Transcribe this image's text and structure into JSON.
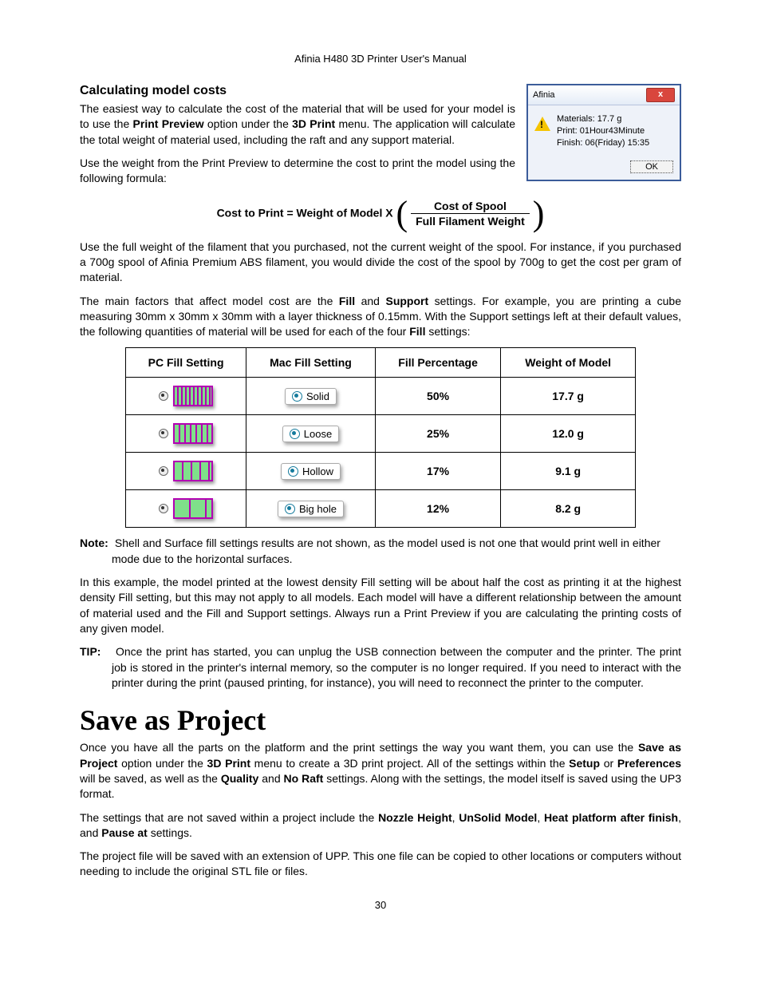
{
  "header": "Afinia H480 3D Printer User's Manual",
  "h_calc": "Calculating model costs",
  "dialog": {
    "title": "Afinia",
    "msg": "Materials: 17.7 g\nPrint: 01Hour43Minute\nFinish: 06(Friday) 15:35",
    "ok": "OK"
  },
  "p1a": "The easiest way to calculate the cost of the material that will be used for your model is to use the ",
  "p1b": "Print Preview",
  "p1c": " option under the ",
  "p1d": "3D Print",
  "p1e": " menu. The application will calculate the total weight of material used, including the raft and any support material.",
  "p2": "Use the weight from the Print Preview to determine the cost to print the model using the following formula:",
  "formula": {
    "lhs": "Cost to Print = Weight of Model X",
    "top": "Cost of Spool",
    "bot": "Full Filament Weight"
  },
  "p3": "Use the full weight of the filament that you purchased, not the current weight of the spool. For instance, if you purchased a 700g spool of Afinia Premium ABS filament, you would divide the cost of the spool by 700g to get the cost per gram of material.",
  "p4a": "The main factors that affect model cost are the ",
  "p4b": "Fill",
  "p4c": " and ",
  "p4d": "Support",
  "p4e": " settings. For example, you are printing a cube measuring 30mm x 30mm x 30mm with a layer thickness of 0.15mm. With the Support settings left at their default values, the following quantities of material will be used for each of the four ",
  "p4f": "Fill",
  "p4g": " settings:",
  "th": {
    "c1": "PC Fill Setting",
    "c2": "Mac Fill Setting",
    "c3": "Fill Percentage",
    "c4": "Weight of Model"
  },
  "rows": [
    {
      "mac": "Solid",
      "pct": "50%",
      "wt": "17.7 g"
    },
    {
      "mac": "Loose",
      "pct": "25%",
      "wt": "12.0 g"
    },
    {
      "mac": "Hollow",
      "pct": "17%",
      "wt": "9.1 g"
    },
    {
      "mac": "Big hole",
      "pct": "12%",
      "wt": "8.2 g"
    }
  ],
  "note_lbl": "Note:",
  "note": " Shell and Surface fill settings results are not shown, as the model used is not one that would print well in either mode due to the horizontal surfaces.",
  "p5": "In this example, the model printed at the lowest density Fill setting will be about half the cost as printing it at the highest density Fill setting, but this may not apply to all models. Each model will have a different relationship between the amount of material used and the Fill and Support settings. Always run a Print Preview if you are calculating the printing costs of any given model.",
  "tip_lbl": "TIP:",
  "tip": " Once the print has started, you can unplug the USB connection between the computer and the printer. The print job is stored in the printer's internal memory, so the computer is no longer required. If you need to interact with the printer during the print (paused printing, for instance), you will need to reconnect the printer to the computer.",
  "h_save": "Save as Project",
  "s1": {
    "a": "Once you have all the parts on the platform and the print settings the way you want them, you can use the ",
    "b": "Save as Project",
    "c": " option under the ",
    "d": "3D Print",
    "e": " menu to create a 3D print project. All of the settings within the ",
    "f": "Setup",
    "g": " or ",
    "h": "Preferences",
    "i": " will be saved, as well as the ",
    "j": "Quality",
    "k": " and ",
    "l": "No Raft",
    "m": " settings. Along with the settings, the model itself is saved using the UP3 format."
  },
  "s2": {
    "a": "The settings that are not saved within a project include the ",
    "b": "Nozzle Height",
    "c": ", ",
    "d": "UnSolid Model",
    "e": ", ",
    "f": "Heat platform after finish",
    "g": ", and ",
    "h": "Pause at",
    "i": " settings."
  },
  "s3": "The project file will be saved with an extension of UPP. This one file can be copied to other locations or computers without needing to include the original STL file or files.",
  "pagenum": "30"
}
